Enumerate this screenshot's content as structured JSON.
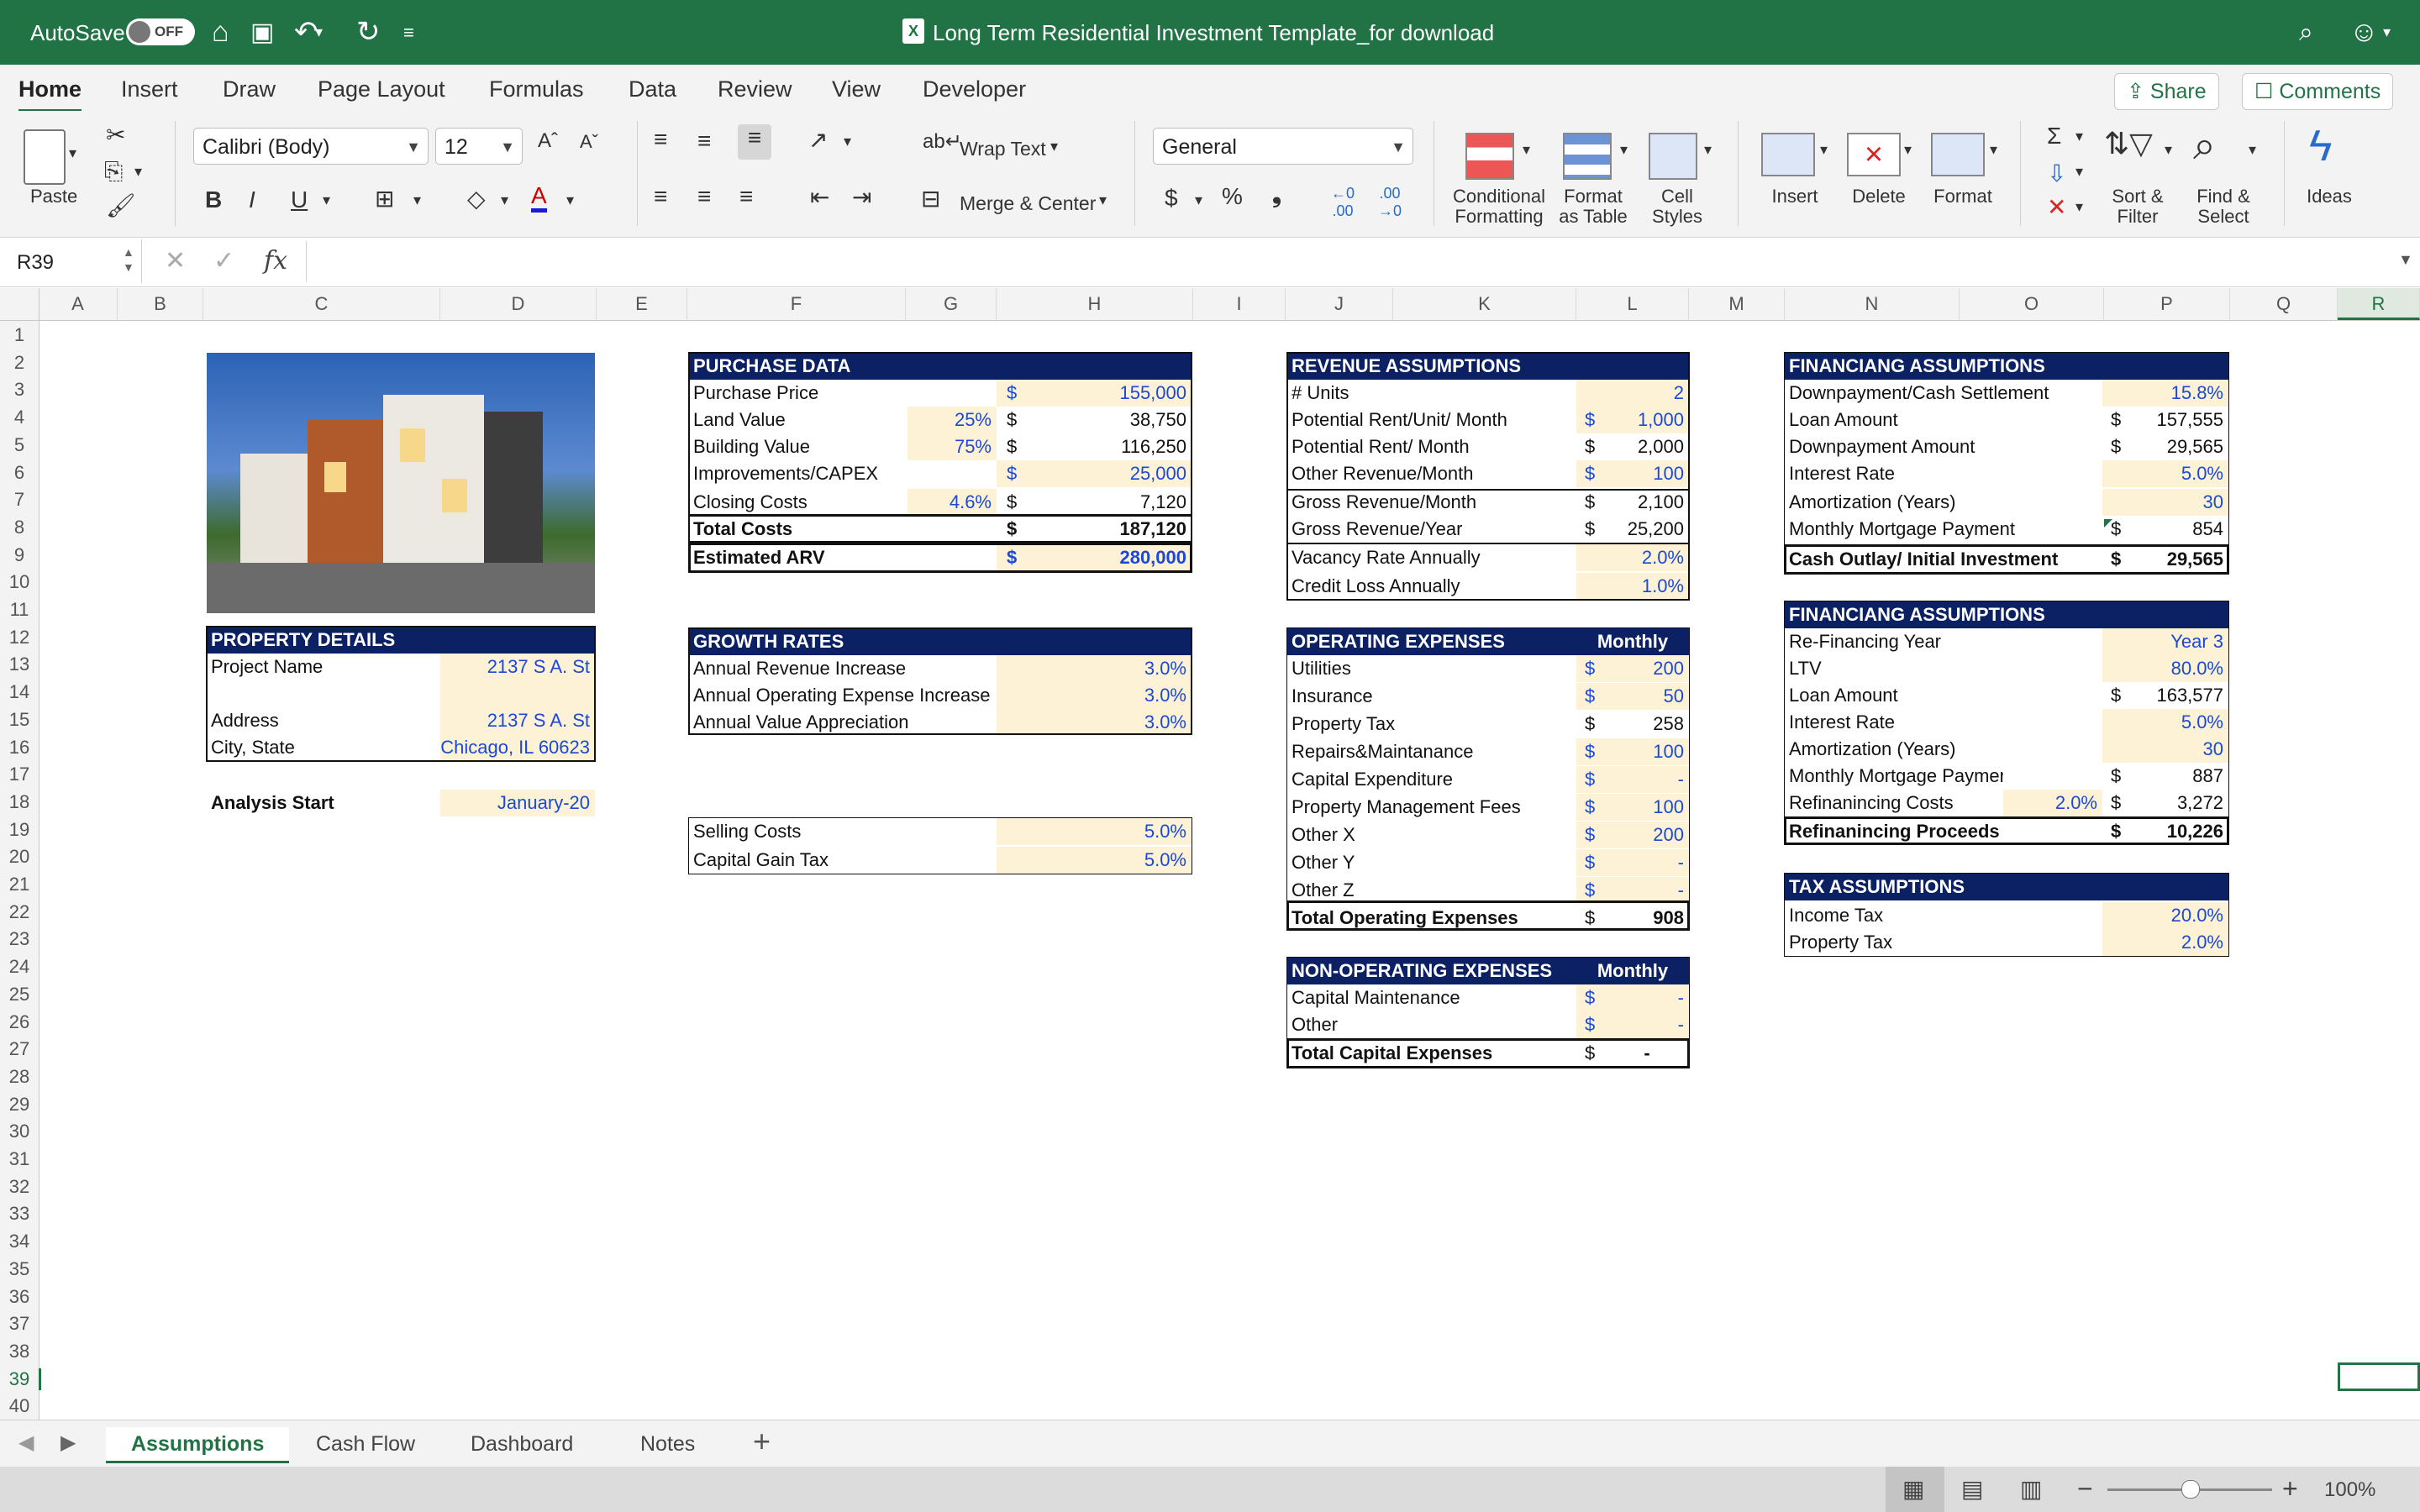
{
  "window": {
    "autosave_label": "AutoSave",
    "autosave_state": "OFF",
    "title": "Long Term Residential Investment Template_for download"
  },
  "tabs": [
    "Home",
    "Insert",
    "Draw",
    "Page Layout",
    "Formulas",
    "Data",
    "Review",
    "View",
    "Developer"
  ],
  "share_label": "Share",
  "comments_label": "Comments",
  "ribbon": {
    "paste": "Paste",
    "font_name": "Calibri (Body)",
    "font_size": "12",
    "wrap_text": "Wrap Text",
    "merge_center": "Merge & Center",
    "number_format": "General",
    "conditional": "Conditional",
    "formatting": "Formatting",
    "format": "Format",
    "as_table": "as Table",
    "cell": "Cell",
    "styles": "Styles",
    "insert": "Insert",
    "delete": "Delete",
    "format_cells": "Format",
    "sort": "Sort &",
    "filter": "Filter",
    "find": "Find &",
    "select": "Select",
    "ideas": "Ideas"
  },
  "formula_bar": {
    "name_box": "R39",
    "fx": "fx",
    "content": ""
  },
  "columns": [
    "A",
    "B",
    "C",
    "D",
    "E",
    "F",
    "G",
    "H",
    "I",
    "J",
    "K",
    "L",
    "M",
    "N",
    "O",
    "P",
    "Q",
    "R"
  ],
  "rows": [
    "1",
    "2",
    "3",
    "4",
    "5",
    "6",
    "7",
    "8",
    "9",
    "10",
    "11",
    "12",
    "13",
    "14",
    "15",
    "16",
    "17",
    "18",
    "19",
    "20",
    "21",
    "22",
    "23",
    "24",
    "25",
    "26",
    "27",
    "28",
    "29",
    "30",
    "31",
    "32",
    "33",
    "34",
    "35",
    "36",
    "37",
    "38",
    "39",
    "40"
  ],
  "property": {
    "header": "PROPERTY DETAILS",
    "project_label": "Project Name",
    "project_value": "2137 S A. St",
    "address_label": "Address",
    "address_value": "2137 S A. St",
    "city_label": "City, State",
    "city_value": "Chicago, IL 60623",
    "analysis_label": "Analysis Start",
    "analysis_value": "January-20"
  },
  "purchase": {
    "header": "PURCHASE DATA",
    "rows": [
      {
        "label": "Purchase Price",
        "pct": "",
        "dollar": "$",
        "value": "155,000"
      },
      {
        "label": "Land Value",
        "pct": "25%",
        "dollar": "$",
        "value": "38,750"
      },
      {
        "label": "Building Value",
        "pct": "75%",
        "dollar": "$",
        "value": "116,250"
      },
      {
        "label": "Improvements/CAPEX",
        "pct": "",
        "dollar": "$",
        "value": "25,000"
      },
      {
        "label": "Closing Costs",
        "pct": "4.6%",
        "dollar": "$",
        "value": "7,120"
      },
      {
        "label": "Total Costs",
        "pct": "",
        "dollar": "$",
        "value": "187,120"
      },
      {
        "label": "Estimated ARV",
        "pct": "",
        "dollar": "$",
        "value": "280,000"
      }
    ]
  },
  "growth": {
    "header": "GROWTH RATES",
    "rows": [
      {
        "label": "Annual Revenue Increase",
        "value": "3.0%"
      },
      {
        "label": "Annual Operating Expense Increase",
        "value": "3.0%"
      },
      {
        "label": "Annual Value Appreciation",
        "value": "3.0%"
      }
    ],
    "selling_label": "Selling Costs",
    "selling_value": "5.0%",
    "cgt_label": "Capital Gain Tax",
    "cgt_value": "5.0%"
  },
  "revenue": {
    "header": "REVENUE ASSUMPTIONS",
    "rows": [
      {
        "label": "# Units",
        "dollar": "",
        "value": "2"
      },
      {
        "label": "Potential Rent/Unit/ Month",
        "dollar": "$",
        "value": "1,000"
      },
      {
        "label": "Potential Rent/ Month",
        "dollar": "$",
        "value": "2,000"
      },
      {
        "label": "Other Revenue/Month",
        "dollar": "$",
        "value": "100"
      },
      {
        "label": "Gross Revenue/Month",
        "dollar": "$",
        "value": "2,100"
      },
      {
        "label": "Gross Revenue/Year",
        "dollar": "$",
        "value": "25,200"
      },
      {
        "label": "Vacancy Rate Annually",
        "dollar": "",
        "value": "2.0%"
      },
      {
        "label": "Credit Loss Annually",
        "dollar": "",
        "value": "1.0%"
      }
    ]
  },
  "opex": {
    "header": "OPERATING EXPENSES",
    "monthly": "Monthly",
    "rows": [
      {
        "label": "Utilities",
        "dollar": "$",
        "value": "200"
      },
      {
        "label": "Insurance",
        "dollar": "$",
        "value": "50"
      },
      {
        "label": "Property Tax",
        "dollar": "$",
        "value": "258"
      },
      {
        "label": "Repairs&Maintanance",
        "dollar": "$",
        "value": "100"
      },
      {
        "label": "Capital Expenditure",
        "dollar": "$",
        "value": "-"
      },
      {
        "label": "Property Management Fees",
        "dollar": "$",
        "value": "100"
      },
      {
        "label": "Other X",
        "dollar": "$",
        "value": "200"
      },
      {
        "label": "Other Y",
        "dollar": "$",
        "value": "-"
      },
      {
        "label": "Other Z",
        "dollar": "$",
        "value": "-"
      },
      {
        "label": "Total Operating Expenses",
        "dollar": "$",
        "value": "908"
      }
    ]
  },
  "nonop": {
    "header": "NON-OPERATING EXPENSES",
    "monthly": "Monthly",
    "rows": [
      {
        "label": "Capital Maintenance",
        "dollar": "$",
        "value": "-"
      },
      {
        "label": "Other",
        "dollar": "$",
        "value": "-"
      },
      {
        "label": "Total Capital Expenses",
        "dollar": "$",
        "value": "-"
      }
    ]
  },
  "financing1": {
    "header": "FINANCIANG ASSUMPTIONS",
    "rows": [
      {
        "label": "Downpayment/Cash Settlement",
        "dollar": "",
        "value": "15.8%"
      },
      {
        "label": "Loan Amount",
        "dollar": "$",
        "value": "157,555"
      },
      {
        "label": "Downpayment Amount",
        "dollar": "$",
        "value": "29,565"
      },
      {
        "label": "Interest Rate",
        "dollar": "",
        "value": "5.0%"
      },
      {
        "label": "Amortization (Years)",
        "dollar": "",
        "value": "30"
      },
      {
        "label": "Monthly Mortgage Payment",
        "dollar": "$",
        "value": "854"
      },
      {
        "label": "Cash Outlay/ Initial Investment",
        "dollar": "$",
        "value": "29,565"
      }
    ]
  },
  "financing2": {
    "header": "FINANCIANG ASSUMPTIONS",
    "rows": [
      {
        "label": "Re-Financing Year",
        "pct": "",
        "dollar": "",
        "value": "Year 3"
      },
      {
        "label": "LTV",
        "pct": "",
        "dollar": "",
        "value": "80.0%"
      },
      {
        "label": "Loan Amount",
        "pct": "",
        "dollar": "$",
        "value": "163,577"
      },
      {
        "label": "Interest Rate",
        "pct": "",
        "dollar": "",
        "value": "5.0%"
      },
      {
        "label": "Amortization (Years)",
        "pct": "",
        "dollar": "",
        "value": "30"
      },
      {
        "label": "Monthly Mortgage Payment",
        "pct": "",
        "dollar": "$",
        "value": "887"
      },
      {
        "label": "Refinanincing Costs",
        "pct": "2.0%",
        "dollar": "$",
        "value": "3,272"
      },
      {
        "label": "Refinanincing Proceeds",
        "pct": "",
        "dollar": "$",
        "value": "10,226"
      }
    ]
  },
  "tax": {
    "header": "TAX ASSUMPTIONS",
    "rows": [
      {
        "label": "Income Tax",
        "value": "20.0%"
      },
      {
        "label": "Property Tax",
        "value": "2.0%"
      }
    ]
  },
  "sheet_tabs": [
    "Assumptions",
    "Cash Flow",
    "Dashboard",
    "Notes"
  ],
  "zoom": "100%"
}
